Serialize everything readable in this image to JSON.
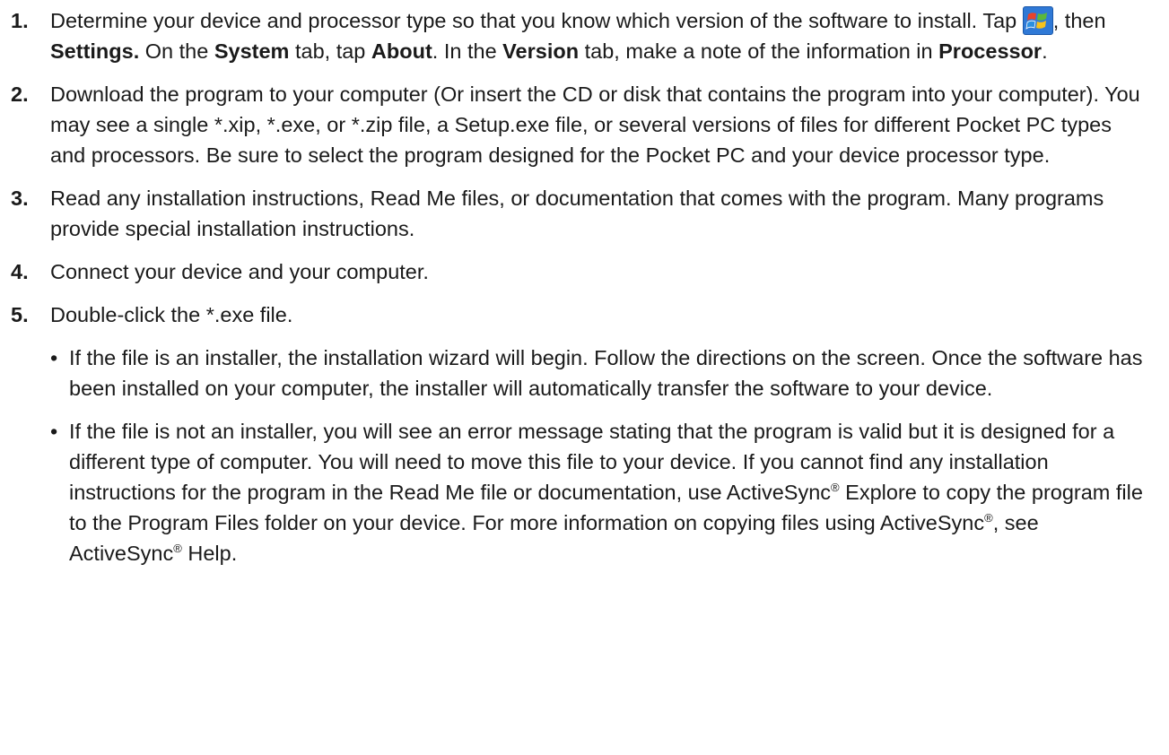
{
  "steps": [
    {
      "num": "1.",
      "t1": "Determine your device and processor type so that you know which version of the software to install. Tap ",
      "t2": ", then ",
      "b1": "Settings.",
      "t3": " On the ",
      "b2": "System",
      "t4": " tab, tap ",
      "b3": "About",
      "t5": ". In the ",
      "b4": "Version",
      "t6": " tab, make a note of the information in ",
      "b5": "Processor",
      "t7": "."
    },
    {
      "num": "2.",
      "text": "Download the program to your computer (Or insert the CD or disk that contains the program into your computer). You may see a single *.xip, *.exe, or *.zip file, a Setup.exe file, or several versions of files for different Pocket PC types and processors. Be sure to select the program designed for the Pocket PC and your device processor type."
    },
    {
      "num": "3.",
      "text": "Read any installation instructions, Read Me files, or documentation that comes with the program. Many programs provide special installation instructions."
    },
    {
      "num": "4.",
      "text": "Connect your device and your computer."
    },
    {
      "num": "5.",
      "text": "Double-click the *.exe file."
    }
  ],
  "bullets": [
    {
      "dot": "•",
      "text": "If the file is an installer, the installation wizard will begin. Follow the directions on the screen. Once the software has been installed on your computer, the installer will automatically transfer the software to your device."
    },
    {
      "dot": "•",
      "t1": "If the file is not an installer, you will see an error message stating that the program is valid but it is designed for a different type of computer. You will need to move this file to your device. If you cannot find any installation instructions for the program in the Read Me file or documentation, use ActiveSync",
      "sup1": "®",
      "t2": " Explore to copy the program file to the Program Files folder on your device. For more information on copying files using ActiveSync",
      "sup2": "®",
      "t3": ", see ActiveSync",
      "sup3": "®",
      "t4": " Help."
    }
  ],
  "icons": {
    "start_icon": "windows-start-flag-icon"
  },
  "colors": {
    "start_button_bg": "#2f79d6"
  }
}
